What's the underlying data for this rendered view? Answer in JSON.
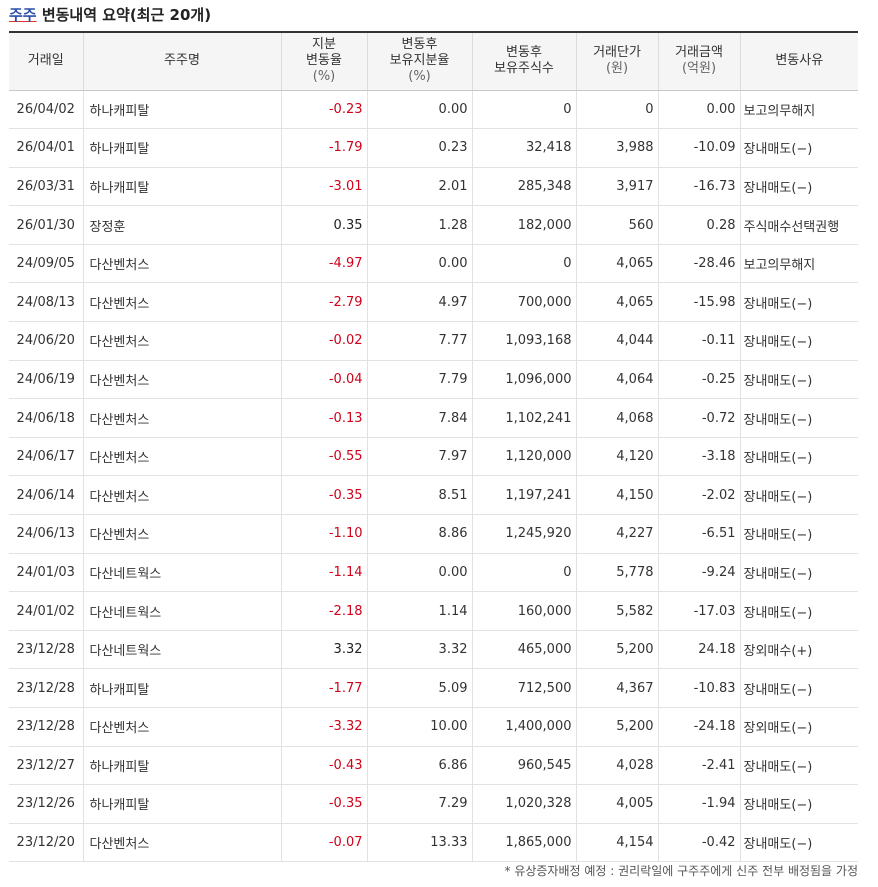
{
  "title": {
    "accent": "주주",
    "rest": " 변동내역 요약(최근 20개)"
  },
  "headers": [
    {
      "lines": [
        "거래일"
      ],
      "unit": ""
    },
    {
      "lines": [
        "주주명"
      ],
      "unit": ""
    },
    {
      "lines": [
        "지분",
        "변동율"
      ],
      "unit": "(%)"
    },
    {
      "lines": [
        "변동후",
        "보유지분율"
      ],
      "unit": "(%)"
    },
    {
      "lines": [
        "변동후",
        "보유주식수"
      ],
      "unit": ""
    },
    {
      "lines": [
        "거래단가"
      ],
      "unit": "(원)"
    },
    {
      "lines": [
        "거래금액"
      ],
      "unit": "(억원)"
    },
    {
      "lines": [
        "변동사유"
      ],
      "unit": ""
    }
  ],
  "rows": [
    {
      "date": "26/04/02",
      "name": "하나캐피탈",
      "change": "-0.23",
      "ratio": "0.00",
      "shares": "0",
      "price": "0",
      "amount": "0.00",
      "reason": "보고의무해지"
    },
    {
      "date": "26/04/01",
      "name": "하나캐피탈",
      "change": "-1.79",
      "ratio": "0.23",
      "shares": "32,418",
      "price": "3,988",
      "amount": "-10.09",
      "reason": "장내매도(−)"
    },
    {
      "date": "26/03/31",
      "name": "하나캐피탈",
      "change": "-3.01",
      "ratio": "2.01",
      "shares": "285,348",
      "price": "3,917",
      "amount": "-16.73",
      "reason": "장내매도(−)"
    },
    {
      "date": "26/01/30",
      "name": "장정훈",
      "change": "0.35",
      "ratio": "1.28",
      "shares": "182,000",
      "price": "560",
      "amount": "0.28",
      "reason": "주식매수선택권행"
    },
    {
      "date": "24/09/05",
      "name": "다산벤처스",
      "change": "-4.97",
      "ratio": "0.00",
      "shares": "0",
      "price": "4,065",
      "amount": "-28.46",
      "reason": "보고의무해지"
    },
    {
      "date": "24/08/13",
      "name": "다산벤처스",
      "change": "-2.79",
      "ratio": "4.97",
      "shares": "700,000",
      "price": "4,065",
      "amount": "-15.98",
      "reason": "장내매도(−)"
    },
    {
      "date": "24/06/20",
      "name": "다산벤처스",
      "change": "-0.02",
      "ratio": "7.77",
      "shares": "1,093,168",
      "price": "4,044",
      "amount": "-0.11",
      "reason": "장내매도(−)"
    },
    {
      "date": "24/06/19",
      "name": "다산벤처스",
      "change": "-0.04",
      "ratio": "7.79",
      "shares": "1,096,000",
      "price": "4,064",
      "amount": "-0.25",
      "reason": "장내매도(−)"
    },
    {
      "date": "24/06/18",
      "name": "다산벤처스",
      "change": "-0.13",
      "ratio": "7.84",
      "shares": "1,102,241",
      "price": "4,068",
      "amount": "-0.72",
      "reason": "장내매도(−)"
    },
    {
      "date": "24/06/17",
      "name": "다산벤처스",
      "change": "-0.55",
      "ratio": "7.97",
      "shares": "1,120,000",
      "price": "4,120",
      "amount": "-3.18",
      "reason": "장내매도(−)"
    },
    {
      "date": "24/06/14",
      "name": "다산벤처스",
      "change": "-0.35",
      "ratio": "8.51",
      "shares": "1,197,241",
      "price": "4,150",
      "amount": "-2.02",
      "reason": "장내매도(−)"
    },
    {
      "date": "24/06/13",
      "name": "다산벤처스",
      "change": "-1.10",
      "ratio": "8.86",
      "shares": "1,245,920",
      "price": "4,227",
      "amount": "-6.51",
      "reason": "장내매도(−)"
    },
    {
      "date": "24/01/03",
      "name": "다산네트웍스",
      "change": "-1.14",
      "ratio": "0.00",
      "shares": "0",
      "price": "5,778",
      "amount": "-9.24",
      "reason": "장내매도(−)"
    },
    {
      "date": "24/01/02",
      "name": "다산네트웍스",
      "change": "-2.18",
      "ratio": "1.14",
      "shares": "160,000",
      "price": "5,582",
      "amount": "-17.03",
      "reason": "장내매도(−)"
    },
    {
      "date": "23/12/28",
      "name": "다산네트웍스",
      "change": "3.32",
      "ratio": "3.32",
      "shares": "465,000",
      "price": "5,200",
      "amount": "24.18",
      "reason": "장외매수(+)"
    },
    {
      "date": "23/12/28",
      "name": "하나캐피탈",
      "change": "-1.77",
      "ratio": "5.09",
      "shares": "712,500",
      "price": "4,367",
      "amount": "-10.83",
      "reason": "장내매도(−)"
    },
    {
      "date": "23/12/28",
      "name": "다산벤처스",
      "change": "-3.32",
      "ratio": "10.00",
      "shares": "1,400,000",
      "price": "5,200",
      "amount": "-24.18",
      "reason": "장외매도(−)"
    },
    {
      "date": "23/12/27",
      "name": "하나캐피탈",
      "change": "-0.43",
      "ratio": "6.86",
      "shares": "960,545",
      "price": "4,028",
      "amount": "-2.41",
      "reason": "장내매도(−)"
    },
    {
      "date": "23/12/26",
      "name": "하나캐피탈",
      "change": "-0.35",
      "ratio": "7.29",
      "shares": "1,020,328",
      "price": "4,005",
      "amount": "-1.94",
      "reason": "장내매도(−)"
    },
    {
      "date": "23/12/20",
      "name": "다산벤처스",
      "change": "-0.07",
      "ratio": "13.33",
      "shares": "1,865,000",
      "price": "4,154",
      "amount": "-0.42",
      "reason": "장내매도(−)"
    }
  ],
  "footnote": "* 유상증자배정 예정 : 권리락일에 구주주에게 신주 전부 배정됨을 가정",
  "colors": {
    "negative": "#d0021b",
    "accent": "#2a4fa8"
  }
}
